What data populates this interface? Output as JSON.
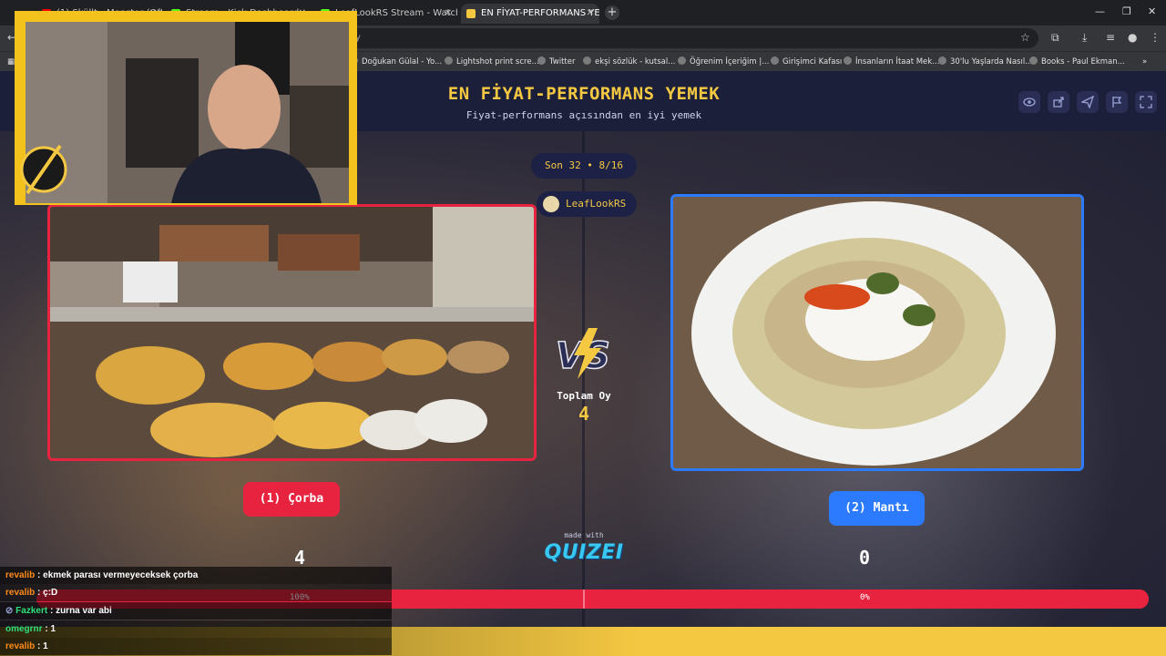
{
  "browser": {
    "tabs": [
      {
        "label": "(1) Sküllt - Monster (Offic",
        "color": "#ff0000"
      },
      {
        "label": "Stream - Kick Dashboard",
        "color": "#53fc18"
      },
      {
        "label": "LeafLookRS Stream - Watch Li",
        "color": "#53fc18"
      },
      {
        "label": "EN FİYAT-PERFORMANS YEMEK",
        "color": "#f5c842"
      }
    ],
    "address": "y",
    "bookmarks": [
      "Doğukan Gülal - Yo...",
      "Lightshot print scre...",
      "Twitter",
      "ekşi sözlük - kutsal...",
      "Öğrenim İçeriğim |...",
      "Girişimci Kafası",
      "İnsanların İtaat Mek...",
      "30'lu Yaşlarda Nasıl...",
      "Books - Paul Ekman..."
    ]
  },
  "header": {
    "title": "EN FİYAT-PERFORMANS YEMEK",
    "subtitle": "Fiyat-performans açısından en iyi yemek"
  },
  "round": "Son 32 • 8/16",
  "user": "LeafLookRS",
  "total": {
    "label": "Toplam Oy",
    "value": "4"
  },
  "options": {
    "left": {
      "label": "(1) Çorba",
      "count": "4",
      "percent": "100%"
    },
    "right": {
      "label": "(2) Mantı",
      "count": "0",
      "percent": "0%"
    }
  },
  "made_with": "made with",
  "brand": "QUIZEI",
  "chat": [
    {
      "user": "revalib",
      "text": " : ekmek parası vermeyeceksek çorba",
      "color": "#ff8c1a"
    },
    {
      "user": "revalib",
      "text": " : ç:D",
      "color": "#ff8c1a"
    },
    {
      "user": "Fazkert",
      "text": " : zurna var abi",
      "color": "#2fe07a"
    },
    {
      "user": "omegrnr",
      "text": " : 1",
      "color": "#2fe07a"
    },
    {
      "user": "revalib",
      "text": " : 1",
      "color": "#ff8c1a"
    }
  ],
  "colors": {
    "left": "#e8233f",
    "right": "#2c7bff",
    "accent": "#f5c842"
  }
}
